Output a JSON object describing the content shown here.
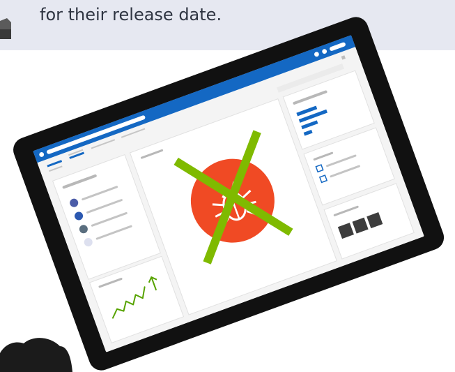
{
  "caption": {
    "text": "for their release date."
  },
  "illustration": {
    "colors": {
      "tablet_frame": "#111111",
      "screen_bg": "#f4f4f4",
      "title_bar": "#1468c3",
      "panel_bg": "#ffffff",
      "panel_border": "#dddddd",
      "placeholder_gray": "#b8b8b8",
      "dark_gray": "#3d3d3d",
      "bug_circle": "#f04a24",
      "cross_mark": "#7fba00",
      "blue_accent": "#1468c3",
      "dot_dark_blue": "#4b5ca8",
      "dot_blue": "#2b58b0",
      "dot_slate": "#5a6e7f",
      "dot_light": "#dde0ef",
      "trend_green": "#57a300"
    },
    "icons": [
      "tablet-device",
      "bug-icon",
      "cross-out-mark",
      "trend-up-arrow-icon",
      "checkbox-icon",
      "avatar-dot-icon",
      "gray-block-icon"
    ]
  }
}
